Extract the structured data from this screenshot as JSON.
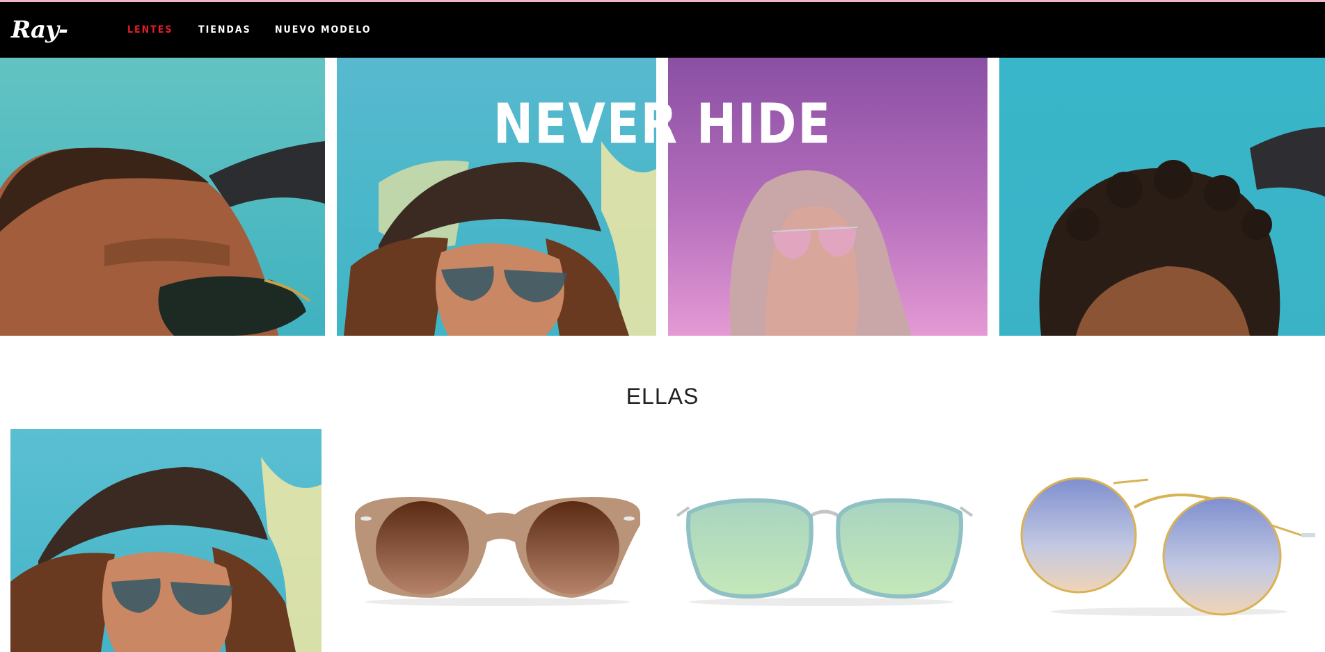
{
  "brand": {
    "logo_text": "Ray-Ban",
    "registered_mark": "®"
  },
  "nav": {
    "items": [
      {
        "label": "LENTES",
        "active": true
      },
      {
        "label": "TIENDAS",
        "active": false
      },
      {
        "label": "NUEVO MODELO",
        "active": false
      }
    ]
  },
  "hero": {
    "title": "NEVER HIDE"
  },
  "section": {
    "title": "ELLAS"
  },
  "colors": {
    "nav_bg": "#000000",
    "nav_active": "#e41d2b",
    "nav_text": "#ffffff",
    "accent_line": "#f2b6c7"
  }
}
